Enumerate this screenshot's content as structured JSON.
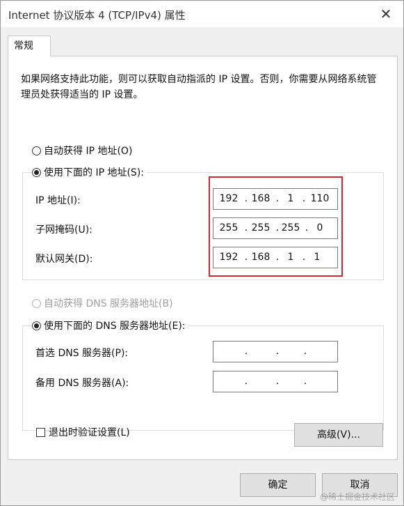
{
  "window": {
    "title": "Internet 协议版本 4 (TCP/IPv4) 属性",
    "close_glyph": "✕"
  },
  "tab": {
    "label": "常规"
  },
  "description": "如果网络支持此功能，则可以获取自动指派的 IP 设置。否则，你需要从网络系统管理员处获得适当的 IP 设置。",
  "ip_section": {
    "auto_label": "自动获得 IP 地址(O)",
    "auto_selected": false,
    "manual_label": "使用下面的 IP 地址(S):",
    "manual_selected": true,
    "fields": [
      {
        "label": "IP 地址(I):",
        "octets": [
          "192",
          "168",
          "1",
          "110"
        ]
      },
      {
        "label": "子网掩码(U):",
        "octets": [
          "255",
          "255",
          "255",
          "0"
        ]
      },
      {
        "label": "默认网关(D):",
        "octets": [
          "192",
          "168",
          "1",
          "1"
        ]
      }
    ]
  },
  "dns_section": {
    "auto_label": "自动获得 DNS 服务器地址(B)",
    "auto_disabled": true,
    "manual_label": "使用下面的 DNS 服务器地址(E):",
    "manual_selected": true,
    "fields": [
      {
        "label": "首选 DNS 服务器(P):",
        "octets": [
          "",
          "",
          "",
          ""
        ]
      },
      {
        "label": "备用 DNS 服务器(A):",
        "octets": [
          "",
          "",
          "",
          ""
        ]
      }
    ]
  },
  "validate_label": "退出时验证设置(L)",
  "validate_checked": false,
  "buttons": {
    "advanced": "高级(V)...",
    "ok": "确定",
    "cancel": "取消"
  },
  "watermark": "@稀土掘金技术社区",
  "colors": {
    "highlight": "#d9262e",
    "dialog_background": "#f0f0f0",
    "button_face": "#e1e1e1"
  }
}
